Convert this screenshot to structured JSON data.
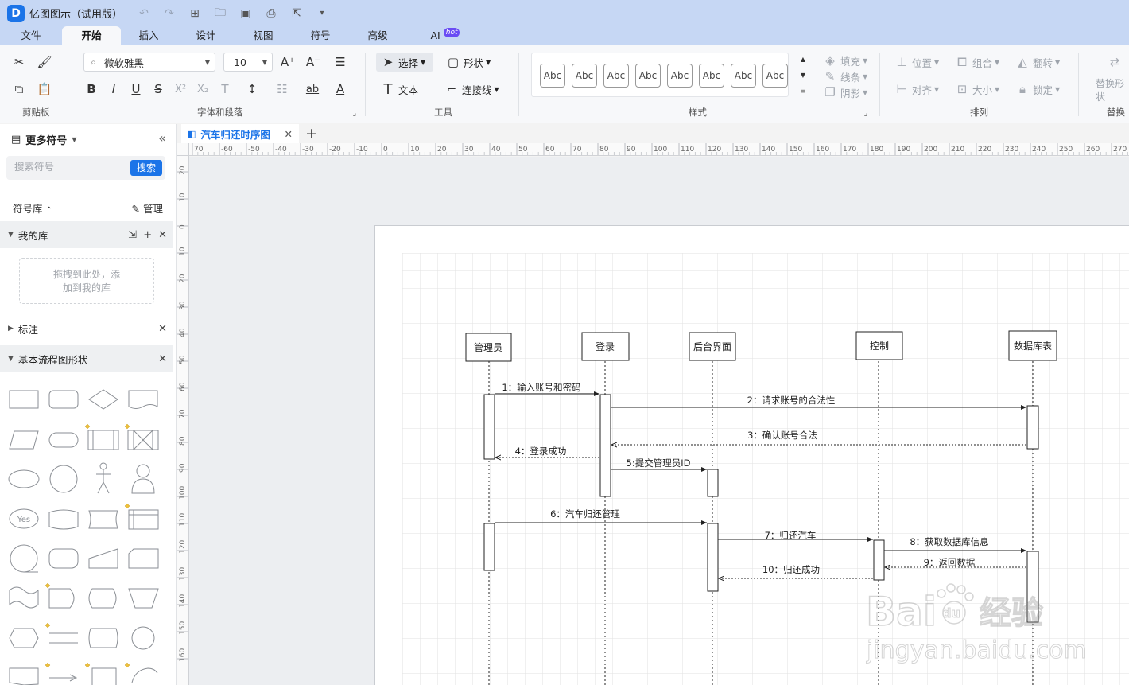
{
  "app": {
    "title": "亿图图示（试用版）",
    "logo_text": "D"
  },
  "menu": {
    "tabs": [
      "文件",
      "开始",
      "插入",
      "设计",
      "视图",
      "符号",
      "高级",
      "AI"
    ],
    "active": "开始",
    "ai_badge": "hot"
  },
  "ribbon": {
    "groups": [
      "剪贴板",
      "字体和段落",
      "工具",
      "样式",
      "排列",
      "替换"
    ],
    "font_name": "微软雅黑",
    "font_size": "10",
    "select_label": "选择",
    "shape_label": "形状",
    "text_label": "文本",
    "connector_label": "连接线",
    "style_samples": [
      "Abc",
      "Abc",
      "Abc",
      "Abc",
      "Abc",
      "Abc",
      "Abc",
      "Abc"
    ],
    "fill_label": "填充",
    "line_label": "线条",
    "shadow_label": "阴影",
    "position_label": "位置",
    "align_label": "对齐",
    "group_label": "组合",
    "size_label": "大小",
    "flip_label": "翻转",
    "lock_label": "锁定",
    "replace_label": "替换形状"
  },
  "left_panel": {
    "title": "更多符号",
    "search_placeholder": "搜索符号",
    "search_button": "搜索",
    "library_label": "符号库",
    "manage_label": "管理",
    "my_library": "我的库",
    "drop_hint_line1": "拖拽到此处，添",
    "drop_hint_line2": "加到我的库",
    "annotation": "标注",
    "basic_flowchart": "基本流程图形状",
    "yes_label": "Yes"
  },
  "document": {
    "tab_title": "汽车归还时序图"
  },
  "ruler": {
    "h_labels": [
      "70",
      "-60",
      "-50",
      "-40",
      "-30",
      "-20",
      "-10",
      "0",
      "10",
      "20",
      "30",
      "40",
      "50",
      "60",
      "70",
      "80",
      "90",
      "100",
      "110",
      "120",
      "130",
      "140",
      "150",
      "160",
      "170",
      "180",
      "190",
      "200",
      "210",
      "220",
      "230",
      "240",
      "250",
      "260",
      "270"
    ],
    "v_labels": [
      "20",
      "10",
      "0",
      "10",
      "20",
      "30",
      "40",
      "50",
      "60",
      "70",
      "80",
      "90",
      "100",
      "110",
      "120",
      "130",
      "140",
      "150",
      "160"
    ]
  },
  "diagram": {
    "lifelines": [
      "管理员",
      "登录",
      "后台界面",
      "控制",
      "数据库表"
    ],
    "messages": [
      "1：输入账号和密码",
      "2：请求账号的合法性",
      "3：确认账号合法",
      "4：登录成功",
      "5:提交管理员ID",
      "6：汽车归还管理",
      "7：归还汽车",
      "8：获取数据库信息",
      "9：返回数据",
      "10：归还成功"
    ]
  },
  "watermark": {
    "brand": "Bai",
    "brand2": "du",
    "brand_cn": "经验",
    "url": "jingyan.baidu.com"
  }
}
